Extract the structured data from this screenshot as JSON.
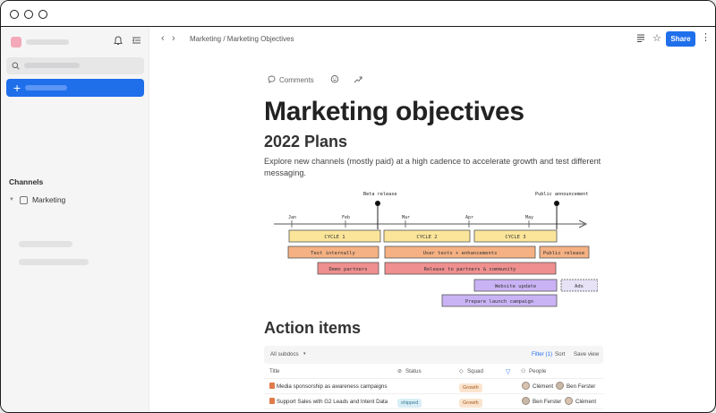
{
  "topbar": {
    "breadcrumb": "Marketing / Marketing Objectives",
    "share_label": "Share"
  },
  "sidebar": {
    "channels_header": "Channels",
    "channels": [
      {
        "label": "Marketing"
      }
    ]
  },
  "doc": {
    "toolbar": {
      "comments_label": "Comments"
    },
    "title": "Marketing objectives",
    "subtitle": "2022 Plans",
    "paragraph": "Explore new channels (mostly paid) at a high cadence to accelerate growth and test different messaging.",
    "action_items_heading": "Action items"
  },
  "roadmap": {
    "milestones": [
      "Beta release",
      "Public announcement"
    ],
    "months": [
      "Jan",
      "Feb",
      "Mar",
      "Apr",
      "May"
    ],
    "bars": [
      {
        "label": "CYCLE 1"
      },
      {
        "label": "CYCLE 2"
      },
      {
        "label": "CYCLE 3"
      },
      {
        "label": "Test internally"
      },
      {
        "label": "User tests + enhancements"
      },
      {
        "label": "Public release"
      },
      {
        "label": "Demo partners"
      },
      {
        "label": "Release to partners & community"
      },
      {
        "label": "Website update"
      },
      {
        "label": "Ads"
      },
      {
        "label": "Prepare launch campaign"
      }
    ]
  },
  "table": {
    "filter_label": "All subdocs",
    "filter_count": "Filter (1)",
    "sort_label": "Sort",
    "save_view_label": "Save view",
    "columns": [
      "Title",
      "Status",
      "Squad",
      "People"
    ],
    "rows": [
      {
        "title": "Media sponsorship as awareness campaigns",
        "status": "",
        "squad": "Growth",
        "people": [
          "Clément",
          "Ben Ferster"
        ]
      },
      {
        "title": "Support Sales with G2 Leads and Intent Data",
        "status": "shipped",
        "squad": "Growth",
        "people": [
          "Ben Ferster",
          "Clément"
        ]
      }
    ]
  },
  "colors": {
    "accent": "#1f6feb",
    "cycle": "#fbe59a",
    "test": "#f5b183",
    "release": "#ef8f8f",
    "campaign": "#c9b3f5"
  }
}
